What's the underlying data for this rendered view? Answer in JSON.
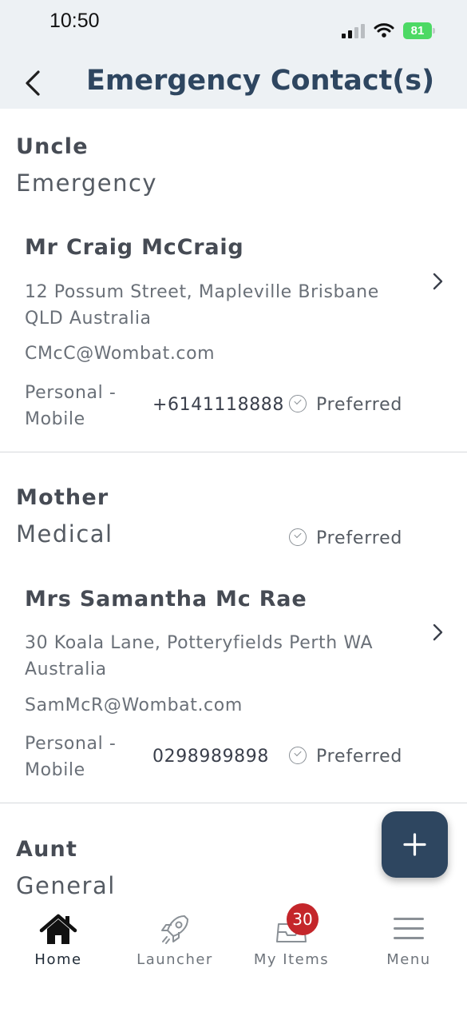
{
  "status_bar": {
    "time": "10:50",
    "battery": "81"
  },
  "header": {
    "title": "Emergency Contact(s)"
  },
  "contacts": [
    {
      "relationship": "Uncle",
      "category": "Emergency",
      "category_preferred": "",
      "name": "Mr Craig McCraig",
      "address": "12 Possum Street, Mapleville Brisbane QLD Australia",
      "email": "CMcC@Wombat.com",
      "phone_type": "Personal - Mobile",
      "phone_number": "+6141118888",
      "phone_preferred": "Preferred"
    },
    {
      "relationship": "Mother",
      "category": "Medical",
      "category_preferred": "Preferred",
      "name": "Mrs Samantha Mc Rae",
      "address": "30 Koala Lane, Potteryfields Perth WA Australia",
      "email": "SamMcR@Wombat.com",
      "phone_type": "Personal - Mobile",
      "phone_number": "0298989898",
      "phone_preferred": "Preferred"
    },
    {
      "relationship": "Aunt",
      "category": "General"
    }
  ],
  "tabs": [
    {
      "label": "Home",
      "icon": "home-icon",
      "active": true
    },
    {
      "label": "Launcher",
      "icon": "rocket-icon",
      "active": false
    },
    {
      "label": "My Items",
      "icon": "inbox-icon",
      "active": false,
      "badge": "30"
    },
    {
      "label": "Menu",
      "icon": "menu-icon",
      "active": false
    }
  ],
  "colors": {
    "accent": "#2e4660",
    "header_bg": "#edf1f4",
    "badge": "#c4262b",
    "battery": "#4cd964"
  }
}
